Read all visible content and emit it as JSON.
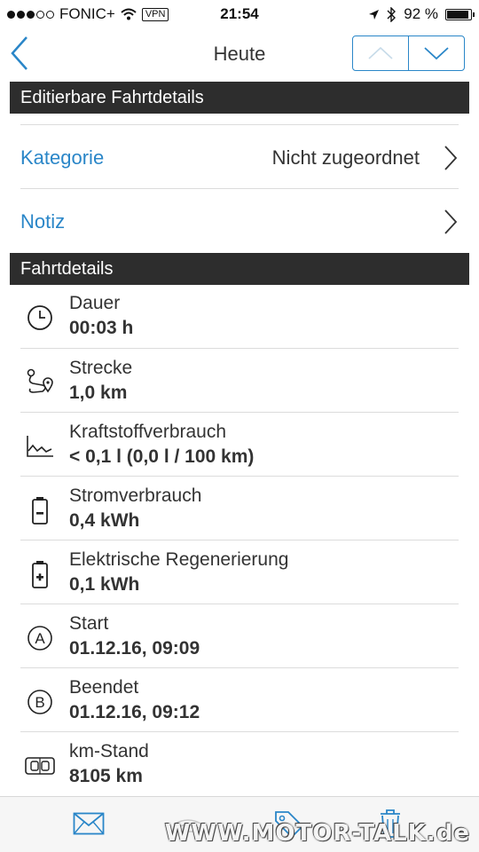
{
  "status_bar": {
    "carrier": "FONIC+",
    "vpn": "VPN",
    "time": "21:54",
    "battery": "92 %",
    "battery_level": 0.92
  },
  "navbar": {
    "title": "Heute"
  },
  "sections": {
    "editable_header": "Editierbare Fahrtdetails",
    "details_header": "Fahrtdetails"
  },
  "editable_rows": [
    {
      "label": "Kategorie",
      "value": "Nicht zugeordnet"
    },
    {
      "label": "Notiz",
      "value": ""
    }
  ],
  "detail_rows": [
    {
      "icon": "clock-icon",
      "title": "Dauer",
      "value": "00:03 h"
    },
    {
      "icon": "route-icon",
      "title": "Strecke",
      "value": "1,0 km"
    },
    {
      "icon": "fuel-chart-icon",
      "title": "Kraftstoffverbrauch",
      "value": "< 0,1 l (0,0 l / 100 km)"
    },
    {
      "icon": "battery-minus-icon",
      "title": "Stromverbrauch",
      "value": "0,4 kWh"
    },
    {
      "icon": "battery-plus-icon",
      "title": "Elektrische Regenerierung",
      "value": "0,1 kWh"
    },
    {
      "icon": "start-a-icon",
      "title": "Start",
      "value": "01.12.16, 09:09"
    },
    {
      "icon": "end-b-icon",
      "title": "Beendet",
      "value": "01.12.16, 09:12"
    },
    {
      "icon": "odometer-icon",
      "title": "km-Stand",
      "value": "8105 km"
    }
  ],
  "watermark": "WWW.MOTOR-TALK.de",
  "colors": {
    "accent": "#2a86c8",
    "header_bg": "#2d2d2d",
    "divider": "#dcdcdc"
  }
}
